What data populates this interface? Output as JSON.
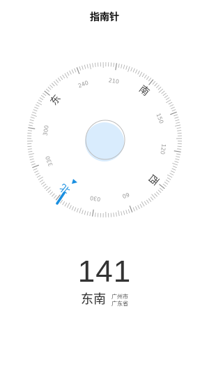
{
  "header": {
    "title": "指南针"
  },
  "compass": {
    "heading_deg": 141,
    "cardinals": {
      "north": "北",
      "east": "东",
      "south": "南",
      "west": "西"
    },
    "degree_labels": [
      "330",
      "300",
      "240",
      "210",
      "150",
      "120",
      "60",
      "030"
    ],
    "accent_color": "#1a8fe0",
    "bubble_color": "#d9ecfd"
  },
  "reading": {
    "value": "141",
    "direction": "东南",
    "city": "广州市",
    "province": "广东省"
  }
}
